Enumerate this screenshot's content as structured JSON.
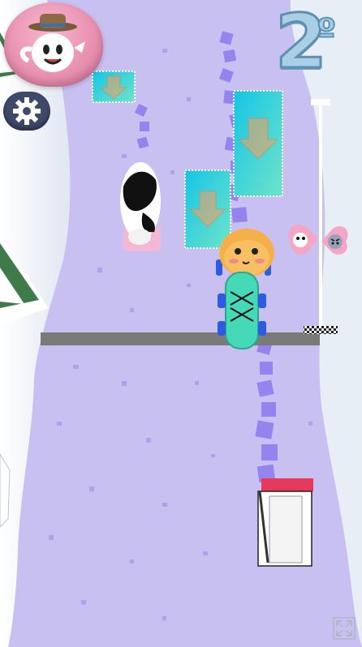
{
  "hud": {
    "place_number": "2",
    "place_suffix": "º",
    "avatar_icon": "teapot-with-hat-icon",
    "settings_icon": "gear-icon",
    "fullscreen_icon": "fullscreen-expand-icon"
  },
  "race": {
    "progress_icons": [
      "cow-avatar-icon",
      "rival-avatar-icon"
    ],
    "finish_flag_icon": "checkered-flag-icon"
  },
  "colors": {
    "snow_ground": "#c9c0f2",
    "trail": "#8f7cf0",
    "boost_pad": "#1fd4e0",
    "player_skate": "#46d9b8",
    "start_line": "#7a7a7a"
  }
}
